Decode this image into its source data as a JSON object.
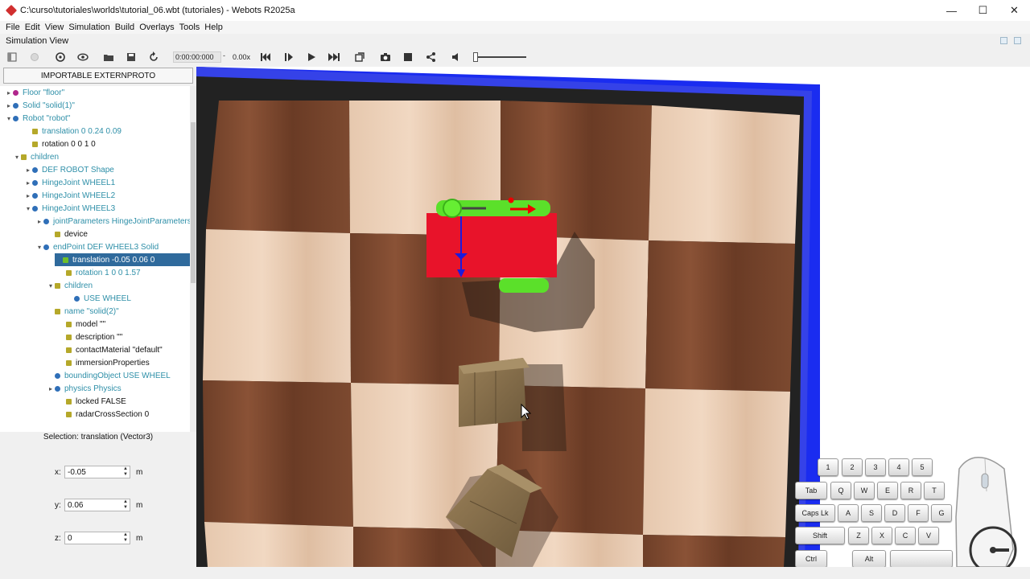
{
  "window": {
    "title": "C:\\curso\\tutoriales\\worlds\\tutorial_06.wbt (tutoriales) - Webots R2025a",
    "minimize": "—",
    "maximize": "☐",
    "close": "✕"
  },
  "menu": [
    "File",
    "Edit",
    "View",
    "Simulation",
    "Build",
    "Overlays",
    "Tools",
    "Help"
  ],
  "simulation_view": {
    "label": "Simulation View"
  },
  "toolbar": {
    "time": "0:00:00:000",
    "speed": "0.00x",
    "speed_separator": "-",
    "icons": [
      "panel-toggle-icon",
      "record-icon",
      "reload-icon",
      "view-eye-icon",
      "open-world-icon",
      "save-world-icon",
      "reset-icon",
      "step-back-icon",
      "step-icon",
      "play-icon",
      "fast-forward-icon",
      "fullscreen-icon",
      "screenshot-icon",
      "record-movie-icon",
      "share-icon",
      "volume-icon"
    ]
  },
  "scene_tree": {
    "extern_button": "IMPORTABLE EXTERNPROTO",
    "rows": [
      {
        "label": "Floor \"floor\"",
        "kind": "node",
        "expander": "▸"
      },
      {
        "label": "Solid \"solid(1)\"",
        "kind": "node",
        "expander": "▸"
      },
      {
        "label": "Robot \"robot\"",
        "kind": "node",
        "expander": "▾"
      },
      {
        "label": "translation 0 0.24 0.09",
        "kind": "field",
        "expander": ""
      },
      {
        "label": "rotation 0 0 1 0",
        "kind": "field",
        "expander": ""
      },
      {
        "label": "children",
        "kind": "field",
        "expander": "▾"
      },
      {
        "label": "DEF ROBOT Shape",
        "kind": "node",
        "expander": "▸"
      },
      {
        "label": "HingeJoint WHEEL1",
        "kind": "node",
        "expander": "▸"
      },
      {
        "label": "HingeJoint WHEEL2",
        "kind": "node",
        "expander": "▸"
      },
      {
        "label": "HingeJoint WHEEL3",
        "kind": "node",
        "expander": "▾"
      },
      {
        "label": "jointParameters HingeJointParameters",
        "kind": "node",
        "expander": "▸"
      },
      {
        "label": "device",
        "kind": "field",
        "expander": ""
      },
      {
        "label": "endPoint DEF WHEEL3 Solid",
        "kind": "node",
        "expander": "▾"
      },
      {
        "label": "translation -0.05 0.06 0",
        "kind": "field",
        "expander": ""
      },
      {
        "label": "rotation 1 0 0 1.57",
        "kind": "field",
        "expander": ""
      },
      {
        "label": "children",
        "kind": "field",
        "expander": "▾"
      },
      {
        "label": "USE WHEEL",
        "kind": "node",
        "expander": ""
      },
      {
        "label": "name \"solid(2)\"",
        "kind": "field",
        "expander": ""
      },
      {
        "label": "model \"\"",
        "kind": "field",
        "expander": ""
      },
      {
        "label": "description \"\"",
        "kind": "field",
        "expander": ""
      },
      {
        "label": "contactMaterial \"default\"",
        "kind": "field",
        "expander": ""
      },
      {
        "label": "immersionProperties",
        "kind": "field",
        "expander": ""
      },
      {
        "label": "boundingObject USE WHEEL",
        "kind": "node",
        "expander": ""
      },
      {
        "label": "physics Physics",
        "kind": "node",
        "expander": "▸"
      },
      {
        "label": "locked FALSE",
        "kind": "field",
        "expander": ""
      },
      {
        "label": "radarCrossSection 0",
        "kind": "field",
        "expander": ""
      }
    ],
    "selected_index": 13
  },
  "field_editor": {
    "selection": "Selection: translation (Vector3)",
    "x": {
      "label": "x:",
      "value": "-0.05",
      "unit": "m"
    },
    "y": {
      "label": "y:",
      "value": "0.06",
      "unit": "m"
    },
    "z": {
      "label": "z:",
      "value": "0",
      "unit": "m"
    }
  },
  "keyboard": {
    "row1": [
      "1",
      "2",
      "3",
      "4",
      "5"
    ],
    "row2": [
      "Tab",
      "Q",
      "W",
      "E",
      "R",
      "T"
    ],
    "row3": [
      "Caps Lk",
      "A",
      "S",
      "D",
      "F",
      "G"
    ],
    "row4": [
      "Shift",
      "Z",
      "X",
      "C",
      "V"
    ],
    "row5": [
      "Ctrl",
      "Alt",
      ""
    ]
  },
  "colors": {
    "node_text": "#2e8fa8",
    "node_dot": "#2f6fb8",
    "field_square": "#b5a82a",
    "selection_bg": "#2f6a9c",
    "arena_wall": "#1a2cf0",
    "robot_body": "#e8132a",
    "wheel": "#5be02a"
  }
}
